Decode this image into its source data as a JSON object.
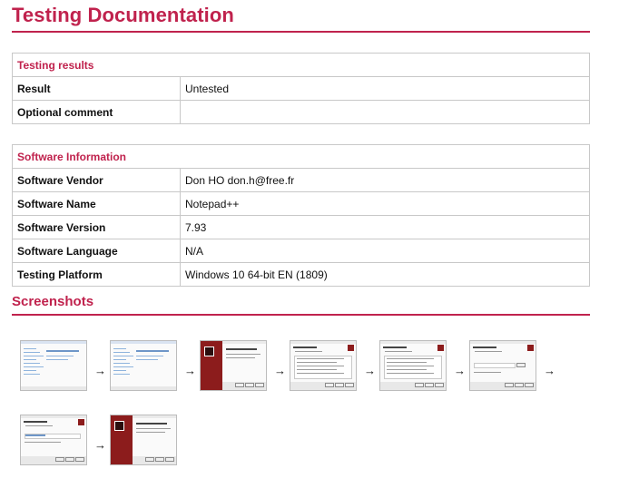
{
  "page": {
    "title": "Testing Documentation",
    "screenshots_heading": "Screenshots"
  },
  "testing_results": {
    "header": "Testing results",
    "rows": [
      {
        "label": "Result",
        "value": "Untested"
      },
      {
        "label": "Optional comment",
        "value": ""
      }
    ]
  },
  "software_information": {
    "header": "Software Information",
    "rows": [
      {
        "label": "Software Vendor",
        "value": "Don HO don.h@free.fr"
      },
      {
        "label": "Software Name",
        "value": "Notepad++"
      },
      {
        "label": "Software Version",
        "value": "7.93"
      },
      {
        "label": "Software Language",
        "value": "N/A"
      },
      {
        "label": "Testing Platform",
        "value": "Windows 10 64-bit EN (1809)"
      }
    ]
  },
  "screenshots": {
    "arrow": "→",
    "items": [
      {
        "kind": "explorer"
      },
      {
        "kind": "explorer"
      },
      {
        "kind": "welcome"
      },
      {
        "kind": "license"
      },
      {
        "kind": "license"
      },
      {
        "kind": "location"
      },
      {
        "kind": "progress"
      },
      {
        "kind": "finish"
      }
    ]
  },
  "colors": {
    "accent": "#c0224d",
    "installer_panel": "#8c1c1c"
  }
}
